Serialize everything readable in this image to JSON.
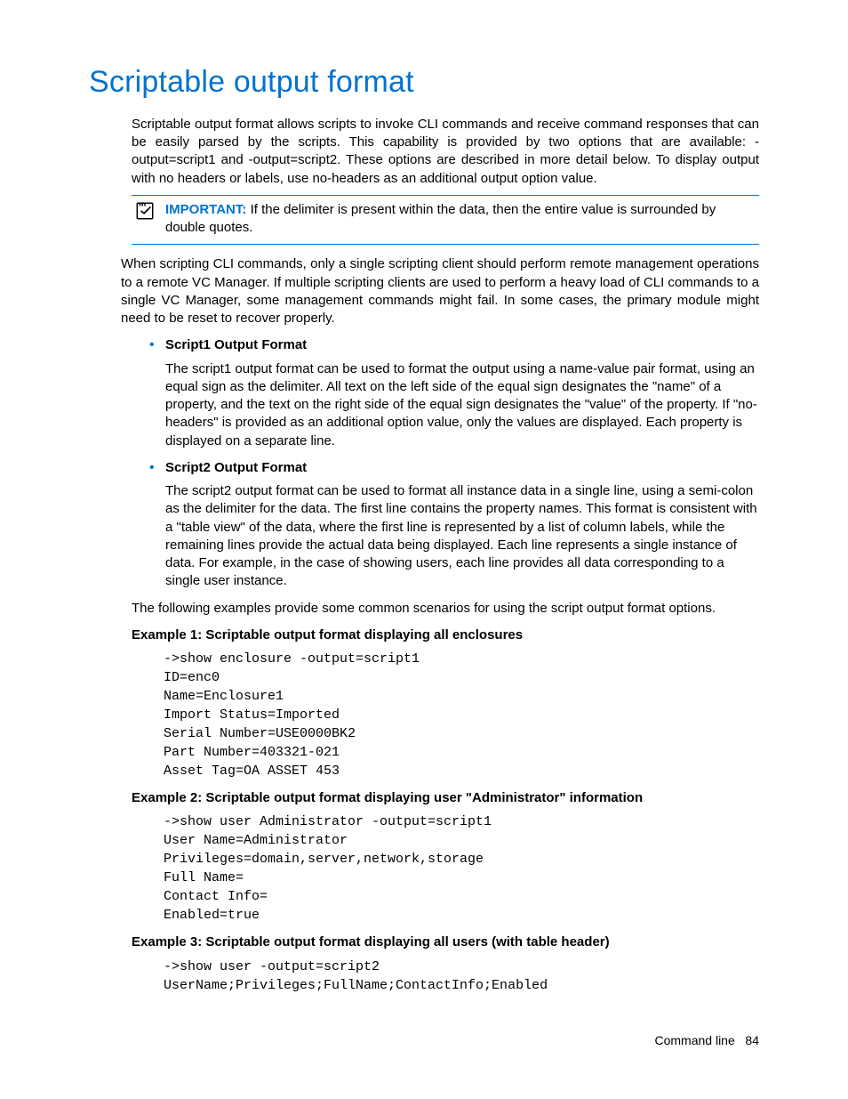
{
  "heading": "Scriptable output format",
  "intro": "Scriptable output format allows scripts to invoke CLI commands and receive command responses that can be easily parsed by the scripts. This capability is provided by two options that are available: -output=script1 and -output=script2. These options are described in more detail below. To display output with no headers or labels, use no-headers as an additional output option value.",
  "callout": {
    "label": "IMPORTANT:",
    "text": "If the delimiter is present within the data, then the entire value is surrounded by double quotes."
  },
  "para2": "When scripting CLI commands, only a single scripting client should perform remote management operations to a remote VC Manager. If multiple scripting clients are used to perform a heavy load of CLI commands to a single VC Manager, some management commands might fail. In some cases, the primary module might need to be reset to recover properly.",
  "bullets": [
    {
      "title": "Script1 Output Format",
      "body": "The script1 output format can be used to format the output using a name-value pair format, using an equal sign as the delimiter. All text on the left side of the equal sign designates the \"name\" of a property, and the text on the right side of the equal sign designates the \"value\" of the property. If \"no-headers\" is provided as an additional option value, only the values are displayed. Each property is displayed on a separate line."
    },
    {
      "title": "Script2 Output Format",
      "body": "The script2 output format can be used to format all instance data in a single line, using a semi-colon as the delimiter for the data. The first line contains the property names. This format is consistent with a \"table view\" of the data, where the first line is represented by a list of column labels, while the remaining lines provide the actual data being displayed. Each line represents a single instance of data. For example, in the case of showing users, each line provides all data corresponding to a single user instance."
    }
  ],
  "examples_intro": "The following examples provide some common scenarios for using the script output format options.",
  "examples": [
    {
      "title": "Example 1: Scriptable output format displaying all enclosures",
      "code": "->show enclosure -output=script1\nID=enc0\nName=Enclosure1\nImport Status=Imported\nSerial Number=USE0000BK2\nPart Number=403321-021\nAsset Tag=OA ASSET 453"
    },
    {
      "title": "Example 2: Scriptable output format displaying user \"Administrator\" information",
      "code": "->show user Administrator -output=script1\nUser Name=Administrator\nPrivileges=domain,server,network,storage\nFull Name=\nContact Info=\nEnabled=true"
    },
    {
      "title": "Example 3: Scriptable output format displaying all users (with table header)",
      "code": "->show user -output=script2\nUserName;Privileges;FullName;ContactInfo;Enabled"
    }
  ],
  "footer": {
    "section": "Command line",
    "page": "84"
  }
}
